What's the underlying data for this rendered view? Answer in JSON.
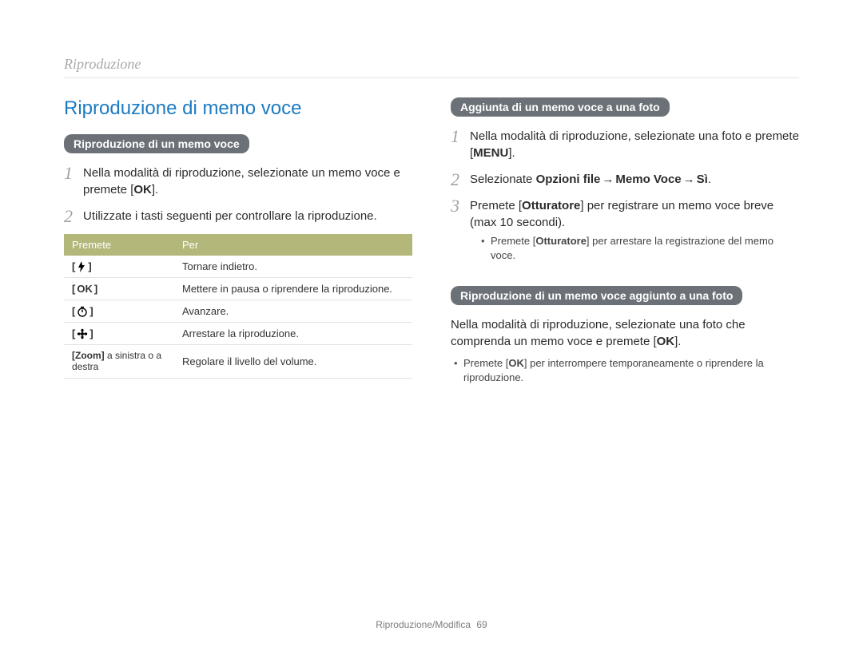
{
  "breadcrumb": "Riproduzione",
  "title": "Riproduzione di memo voce",
  "left": {
    "pill": "Riproduzione di un memo voce",
    "step1_a": "Nella modalità di riproduzione, selezionate un memo voce e premete [",
    "step1_btn": "OK",
    "step1_b": "].",
    "step2": "Utilizzate i tasti seguenti per controllare la riproduzione.",
    "table": {
      "head_a": "Premete",
      "head_b": "Per",
      "rows": [
        {
          "icon": "flash-icon",
          "label": "",
          "desc": "Tornare indietro."
        },
        {
          "icon": "ok-icon",
          "label": "OK",
          "desc": "Mettere in pausa o riprendere la riproduzione."
        },
        {
          "icon": "timer-icon",
          "label": "",
          "desc": "Avanzare."
        },
        {
          "icon": "flower-icon",
          "label": "",
          "desc": "Arrestare la riproduzione."
        },
        {
          "icon": "",
          "label": "[Zoom] a sinistra o a destra",
          "desc": "Regolare il livello del volume."
        }
      ]
    }
  },
  "right": {
    "pill_a": "Aggiunta di un memo voce a una foto",
    "step1_a": "Nella modalità di riproduzione, selezionate una foto e premete [",
    "step1_btn": "MENU",
    "step1_b": "].",
    "step2_a": "Selezionate ",
    "step2_b": "Opzioni file",
    "step2_arrow": " → ",
    "step2_c": "Memo Voce",
    "step2_d": "Sì",
    "step2_e": ".",
    "step3_a": "Premete [",
    "step3_btn": "Otturatore",
    "step3_b": "] per registrare un memo voce breve (max 10 secondi).",
    "sub_a1": "Premete [",
    "sub_a_btn": "Otturatore",
    "sub_a2": "] per arrestare la registrazione del memo voce.",
    "pill_b": "Riproduzione di un memo voce aggiunto a una foto",
    "para_b1": "Nella modalità di riproduzione, selezionate una foto che comprenda un memo voce e premete [",
    "para_b_btn": "OK",
    "para_b2": "].",
    "sub_b1": "Premete [",
    "sub_b_btn": "OK",
    "sub_b2": "] per interrompere temporaneamente o riprendere la riproduzione."
  },
  "footer": {
    "label": "Riproduzione/Modifica",
    "page": "69"
  },
  "chart_data": {
    "type": "table",
    "title": "Tasti di controllo riproduzione memo voce",
    "columns": [
      "Premete",
      "Per"
    ],
    "rows": [
      [
        "[flash]",
        "Tornare indietro."
      ],
      [
        "[OK]",
        "Mettere in pausa o riprendere la riproduzione."
      ],
      [
        "[timer]",
        "Avanzare."
      ],
      [
        "[flower]",
        "Arrestare la riproduzione."
      ],
      [
        "[Zoom] a sinistra o a destra",
        "Regolare il livello del volume."
      ]
    ]
  }
}
